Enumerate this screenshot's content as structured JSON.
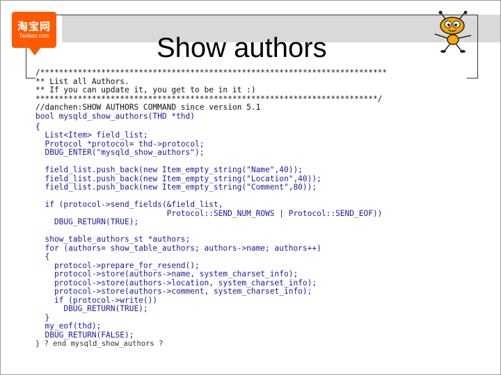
{
  "slide": {
    "title": "Show authors",
    "logo": {
      "main_text": "淘宝网",
      "sub_text": "Taobao.com"
    }
  },
  "code": {
    "lines": [
      "/**************************************************************************",
      "** List all Authors.",
      "** If you can update it, you get to be in it :)",
      "*************************************************************************/",
      "//danchen:SHOW AUTHORS COMMAND since version 5.1",
      "bool mysqld_show_authors(THD *thd)",
      "{",
      "  List<Item> field_list;",
      "  Protocol *protocol= thd->protocol;",
      "  DBUG_ENTER(\"mysqld_show_authors\");",
      "",
      "  field_list.push_back(new Item_empty_string(\"Name\",40));",
      "  field_list.push_back(new Item_empty_string(\"Location\",40));",
      "  field_list.push_back(new Item_empty_string(\"Comment\",80));",
      "",
      "  if (protocol->send_fields(&field_list,",
      "                            Protocol::SEND_NUM_ROWS | Protocol::SEND_EOF))",
      "    DBUG_RETURN(TRUE);",
      "",
      "  show_table_authors_st *authors;",
      "  for (authors= show_table_authors; authors->name; authors++)",
      "  {",
      "    protocol->prepare_for_resend();",
      "    protocol->store(authors->name, system_charset_info);",
      "    protocol->store(authors->location, system_charset_info);",
      "    protocol->store(authors->comment, system_charset_info);",
      "    if (protocol->write())",
      "      DBUG_RETURN(TRUE);",
      "  }",
      "  my_eof(thd);",
      "  DBUG_RETURN(FALSE);",
      "} ? end mysqld_show_authors ?"
    ]
  }
}
